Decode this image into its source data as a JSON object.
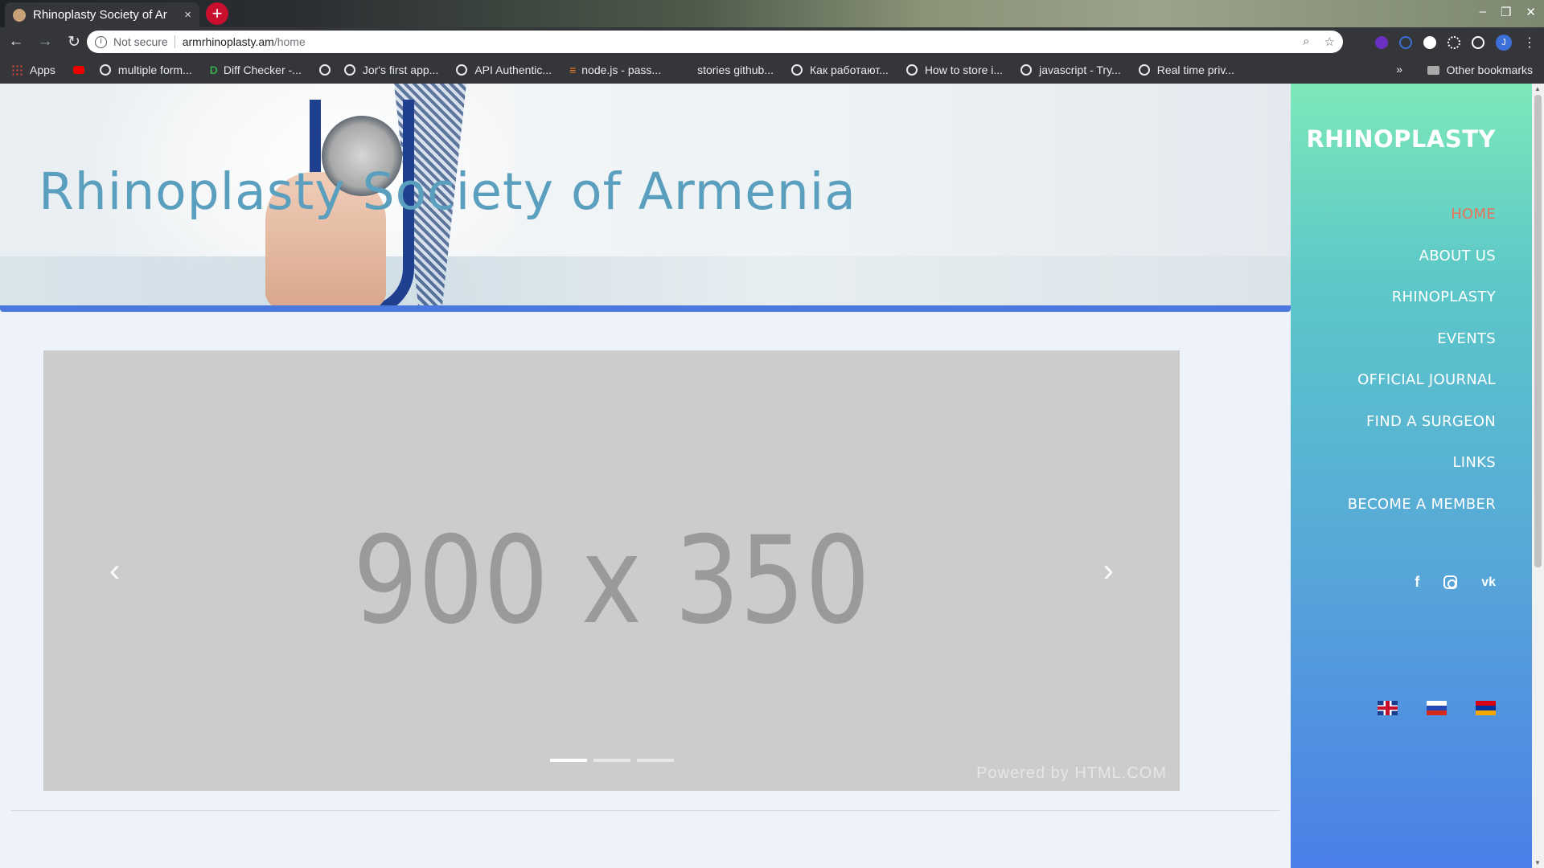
{
  "browser": {
    "tab_title": "Rhinoplasty Society of Ar",
    "tab_close": "×",
    "new_tab": "+",
    "window_controls": [
      "–",
      "❐",
      "✕"
    ],
    "security_label": "Not secure",
    "url_host": "armrhinoplasty.am",
    "url_path": "/home",
    "bookmarks": [
      {
        "label": "Apps",
        "icon": "apps-icon"
      },
      {
        "label": "multiple form...",
        "icon": "globe-icon"
      },
      {
        "label": "Diff Checker -...",
        "icon": "diffchecker-icon"
      },
      {
        "label": "",
        "icon": "globe-icon"
      },
      {
        "label": "Jor's first app...",
        "icon": "globe-icon"
      },
      {
        "label": "API Authentic...",
        "icon": "globe-icon"
      },
      {
        "label": "node.js - pass...",
        "icon": "stackoverflow-icon"
      },
      {
        "label": "stories github...",
        "icon": "github-icon"
      },
      {
        "label": "Как работают...",
        "icon": "globe-icon"
      },
      {
        "label": "How to store i...",
        "icon": "globe-icon"
      },
      {
        "label": "javascript - Try...",
        "icon": "globe-icon"
      },
      {
        "label": "Real time priv...",
        "icon": "globe-icon"
      }
    ],
    "bookmarks_more": "»",
    "other_bookmarks": "Other bookmarks",
    "profile_initial": "J"
  },
  "hero": {
    "title": "Rhinoplasty Society of Armenia"
  },
  "carousel": {
    "placeholder": "900 x 350",
    "powered_by": "Powered by HTML.COM",
    "prev": "‹",
    "next": "›",
    "slides": 3,
    "active_slide": 1
  },
  "sidebar": {
    "brand": "RHINOPLASTY",
    "menu": [
      {
        "label": "HOME",
        "active": true
      },
      {
        "label": "ABOUT US"
      },
      {
        "label": "RHINOPLASTY"
      },
      {
        "label": "EVENTS"
      },
      {
        "label": "OFFICIAL JOURNAL"
      },
      {
        "label": "FIND A SURGEON"
      },
      {
        "label": "LINKS"
      },
      {
        "label": "BECOME A MEMBER"
      }
    ],
    "social": [
      "facebook-icon",
      "instagram-icon",
      "vk-icon"
    ],
    "languages": [
      "uk-flag-icon",
      "russia-flag-icon",
      "armenia-flag-icon"
    ]
  },
  "colors": {
    "accent_bar": "#4a78dd",
    "title": "#5b9fbf",
    "active_menu": "#e8735a"
  }
}
